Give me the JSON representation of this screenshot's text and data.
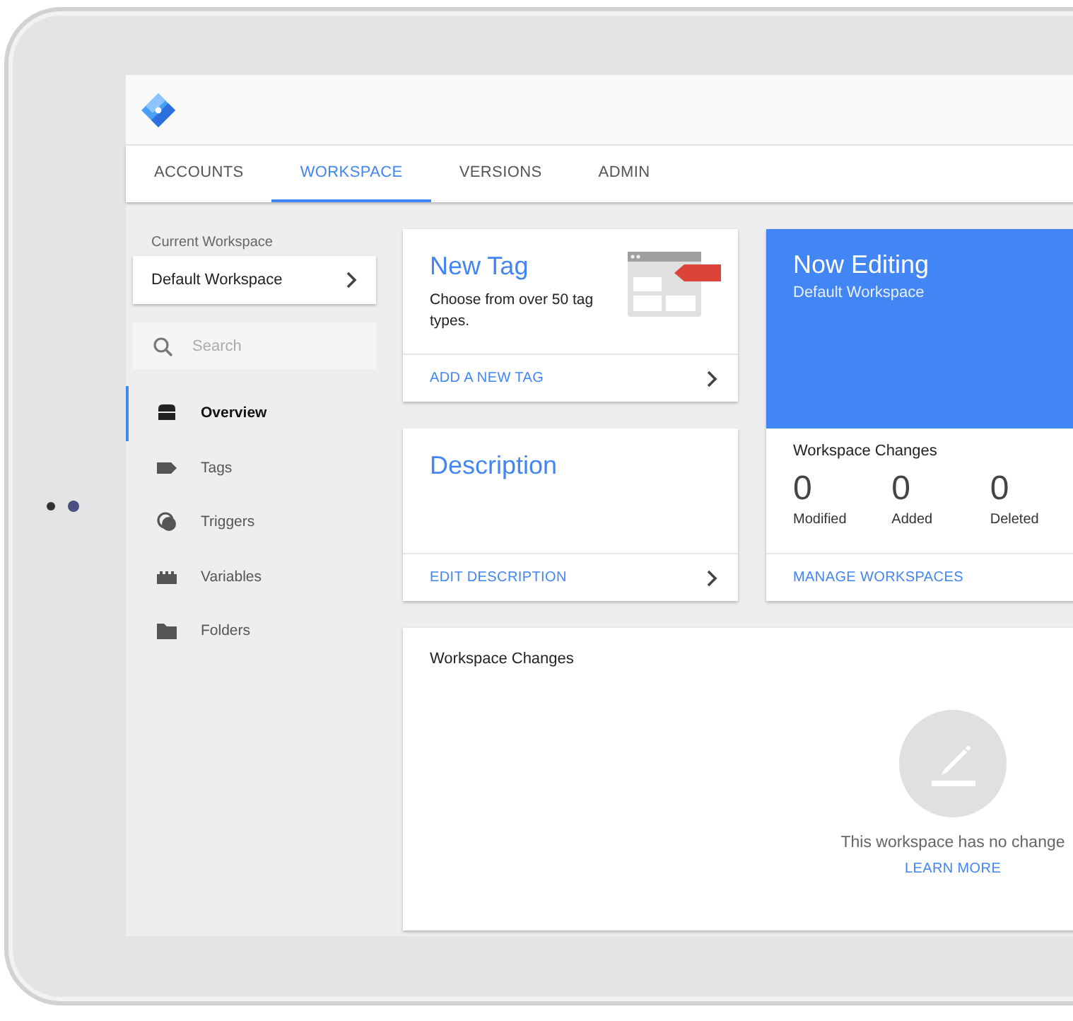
{
  "tabs": [
    {
      "label": "ACCOUNTS",
      "selected": false
    },
    {
      "label": "WORKSPACE",
      "selected": true
    },
    {
      "label": "VERSIONS",
      "selected": false
    },
    {
      "label": "ADMIN",
      "selected": false
    }
  ],
  "sidebar": {
    "workspace_label": "Current Workspace",
    "workspace": "Default Workspace",
    "search": {
      "placeholder": "Search"
    },
    "items": [
      {
        "label": "Overview",
        "kind": "overview",
        "selected": true
      },
      {
        "label": "Tags",
        "kind": "tags",
        "selected": false
      },
      {
        "label": "Triggers",
        "kind": "triggers",
        "selected": false
      },
      {
        "label": "Variables",
        "kind": "variables",
        "selected": false
      },
      {
        "label": "Folders",
        "kind": "folders",
        "selected": false
      }
    ]
  },
  "new_tag_card": {
    "title": "New Tag",
    "text": "Choose from over 50 tag types.",
    "link": "ADD A NEW TAG"
  },
  "description_card": {
    "title": "Description",
    "link": "EDIT DESCRIPTION"
  },
  "now_editing_card": {
    "title": "Now Editing",
    "workspace": "Default Workspace",
    "changes_title": "Workspace Changes",
    "stats": [
      {
        "value": "0",
        "label": "Modified"
      },
      {
        "value": "0",
        "label": "Added"
      },
      {
        "value": "0",
        "label": "Deleted"
      }
    ],
    "link": "MANAGE WORKSPACES"
  },
  "changes_panel": {
    "title": "Workspace Changes",
    "message": "This workspace has no change",
    "link": "LEARN MORE"
  }
}
